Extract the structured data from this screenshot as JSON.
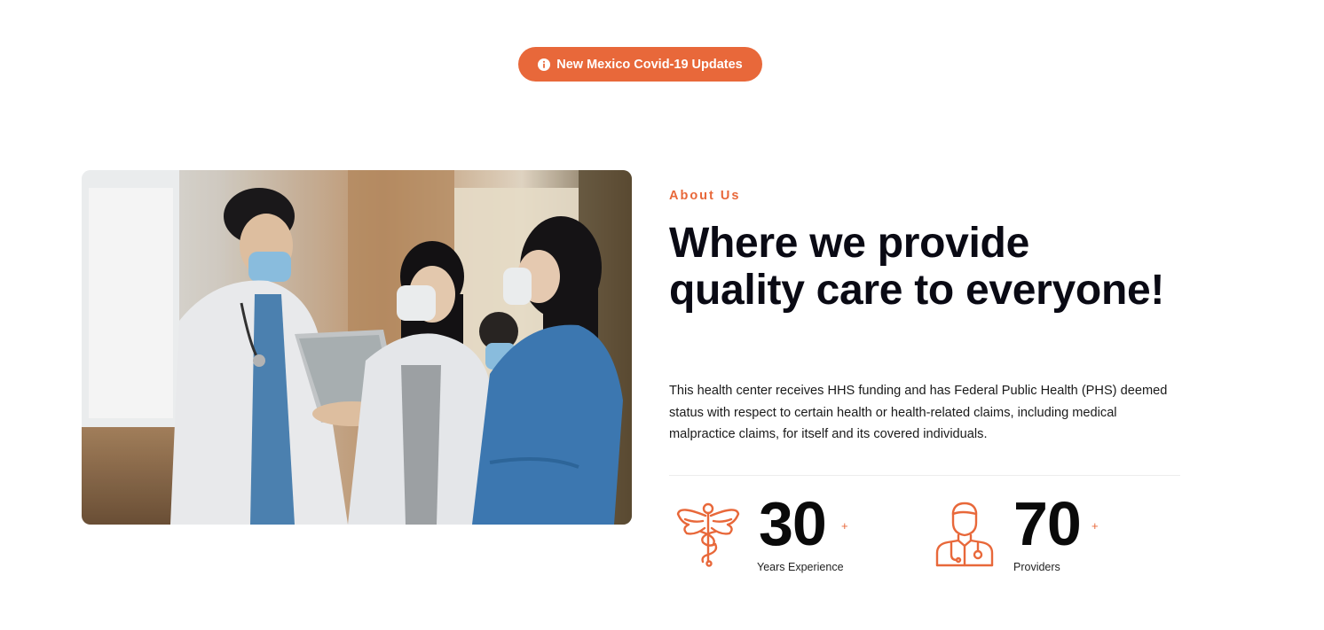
{
  "banner": {
    "button_label": "New Mexico Covid-19 Updates",
    "icon": "info-circle-icon",
    "accent_color": "#e8683a"
  },
  "about": {
    "eyebrow": "About Us",
    "headline": "Where we provide quality care to everyone!",
    "body": "This health center receives HHS funding and has Federal Public Health (PHS) deemed status with respect to certain health or health-related claims, including medical malpractice claims, for itself and its covered individuals.",
    "image_icon": "medical-staff-photo"
  },
  "stats": [
    {
      "icon": "caduceus-icon",
      "number": "30",
      "suffix": "+",
      "label": "Years Experience"
    },
    {
      "icon": "doctor-icon",
      "number": "70",
      "suffix": "+",
      "label": "Providers"
    }
  ]
}
